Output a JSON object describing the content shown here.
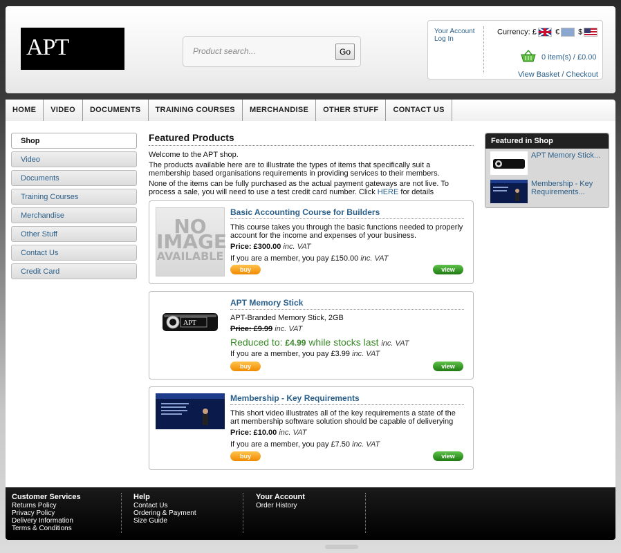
{
  "header": {
    "logo_text": "APT",
    "search": {
      "placeholder": "Product search...",
      "button": "Go"
    },
    "account": {
      "your_account": "Your Account",
      "log_in": "Log In",
      "currency_label": "Currency:",
      "currencies": [
        "£",
        "€",
        "$"
      ],
      "basket_summary": "0 item(s) / £0.00",
      "view_basket": "View Basket / Checkout"
    }
  },
  "nav": {
    "items": [
      "HOME",
      "VIDEO",
      "DOCUMENTS",
      "TRAINING COURSES",
      "MERCHANDISE",
      "OTHER STUFF",
      "CONTACT US"
    ]
  },
  "sidebar": {
    "items": [
      "Shop",
      "Video",
      "Documents",
      "Training Courses",
      "Merchandise",
      "Other Stuff",
      "Contact Us",
      "Credit Card"
    ]
  },
  "content": {
    "title": "Featured Products",
    "intro": {
      "p1": "Welcome to the APT shop.",
      "p2": "The products available here are to illustrate the types of items that specifically suit a membership based organisations requirements in providing services to their members.",
      "p3": "None of the items can be fully purchased as the actual payment gateways are not live. To process a sale, you will need to use a test credit card number. Click",
      "p3_link": "HERE",
      "p3_end": "for details"
    },
    "no_image": {
      "line1": "NO",
      "line2": "IMAGE",
      "line3": "AVAILABLE"
    },
    "buy_label": "buy",
    "view_label": "view",
    "vat": "inc. VAT",
    "products": [
      {
        "title": "Basic Accounting Course for Builders",
        "description": "This course takes you through the basic functions needed to properly account for the income and expenses of your business.",
        "price_label": "Price:",
        "price": "£300.00",
        "member_text": "If you are a member, you pay £150.00"
      },
      {
        "title": "APT Memory Stick",
        "description": "APT-Branded Memory Stick, 2GB",
        "price_label": "Price:",
        "price": "£9.99",
        "reduced_prefix": "Reduced to:",
        "reduced_price": "£4.99",
        "reduced_suffix": "while stocks last",
        "member_text": "If you are a member, you pay £3.99"
      },
      {
        "title": "Membership - Key Requirements",
        "description": "This short video illustrates all of the key requirements a state of the art membership software solution should be capable of deliverying",
        "price_label": "Price:",
        "price": "£10.00",
        "member_text": "If you are a member, you pay £7.50"
      }
    ]
  },
  "featured": {
    "title": "Featured in Shop",
    "items": [
      "APT Memory Stick...",
      "Membership - Key Requirements..."
    ]
  },
  "footer": {
    "customer_services": {
      "title": "Customer Services",
      "links": [
        "Returns Policy",
        "Privacy Policy",
        "Delivery Information",
        "Terms & Conditions"
      ]
    },
    "help": {
      "title": "Help",
      "links": [
        "Contact Us",
        "Ordering & Payment",
        "Size Guide"
      ]
    },
    "your_account": {
      "title": "Your Account",
      "links": [
        "Order History"
      ]
    }
  },
  "colors": {
    "link": "#2a5f8a",
    "buy_button": "#f08a00",
    "view_button": "#1f7a12",
    "reduced_price": "#3a8a2a"
  }
}
